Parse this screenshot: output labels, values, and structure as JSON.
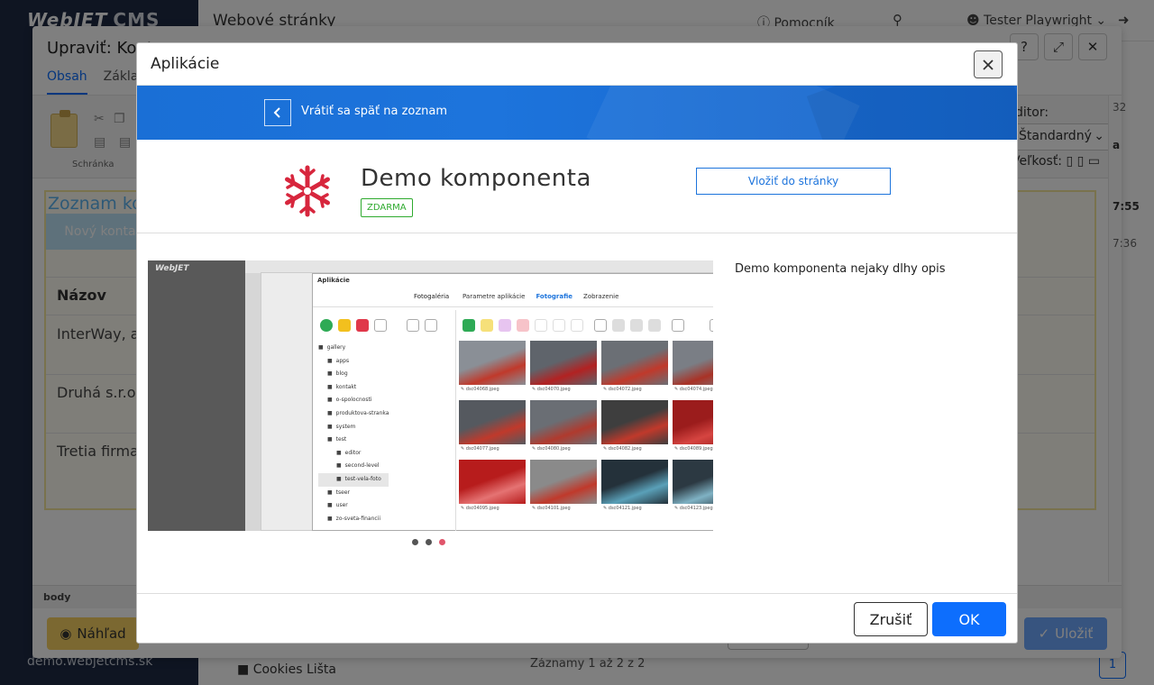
{
  "background_app": {
    "logo_text": "WebJET",
    "logo_cms": "CMS",
    "page_title": "Webové stránky",
    "help_label": "Pomocník",
    "user_label": "Tester Playwright",
    "domain_label": "demo.webjetcms.sk",
    "folder_label": "Cookies Lišta",
    "records_label": "Záznamy 1 až 2 z 2",
    "pagination_current": "1"
  },
  "editor_window": {
    "title": "Upraviť: Kont",
    "tabs": [
      "Obsah",
      "Základ"
    ],
    "active_tab_index": 0,
    "clipboard_label": "Schránka",
    "editor_label": "ditor:",
    "editor_select_value": "Štandardný",
    "size_label": "Veľkosť:",
    "right_number": "32",
    "right_time_1": "7:55",
    "right_time_2": "7:36",
    "right_letter": "a",
    "content": {
      "heading": "Zoznam kon",
      "new_button": "Nový konta",
      "column_header": "Názov",
      "rows": [
        "InterWay, a.",
        "Druhá s.r.o.",
        "Tretia firma a"
      ]
    },
    "status_path": "body",
    "preview_button": "Náhľad",
    "save_button": "Uložiť"
  },
  "modal": {
    "title": "Aplikácie",
    "back_label": "Vrátiť sa späť na zoznam",
    "app_name": "Demo komponenta",
    "price_badge": "ZDARMA",
    "insert_button": "Vložiť do stránky",
    "description": "Demo komponenta nejaky dlhy opis",
    "slides_count": 3,
    "active_slide_index": 2,
    "cancel_button": "Zrušiť",
    "ok_button": "OK",
    "colors": {
      "banner": "#1d74dc",
      "primary": "#0d6efd",
      "icon": "#d7263d",
      "free_badge": "#2eaa2e",
      "dot_active": "#e0556b"
    }
  },
  "slide_screenshot": {
    "dialog_title": "Aplikácie",
    "gallery_label": "Fotogaléria",
    "tabs": [
      "Parametre aplikácie",
      "Fotografie",
      "Zobrazenie"
    ],
    "active_tab_index": 1,
    "tree": [
      {
        "label": "gallery",
        "depth": 0
      },
      {
        "label": "apps",
        "depth": 1
      },
      {
        "label": "blog",
        "depth": 1
      },
      {
        "label": "kontakt",
        "depth": 1
      },
      {
        "label": "o-spolocnosti",
        "depth": 1
      },
      {
        "label": "produktova-stranka",
        "depth": 1
      },
      {
        "label": "system",
        "depth": 1
      },
      {
        "label": "test",
        "depth": 1
      },
      {
        "label": "editor",
        "depth": 2
      },
      {
        "label": "second-level",
        "depth": 2
      },
      {
        "label": "test-vela-foto",
        "depth": 2
      },
      {
        "label": "tseer",
        "depth": 1
      },
      {
        "label": "user",
        "depth": 1
      },
      {
        "label": "zo-sveta-financii",
        "depth": 1
      }
    ],
    "images": [
      "dsc04068.jpeg",
      "dsc04070.jpeg",
      "dsc04072.jpeg",
      "dsc04074.jpeg",
      "dsc04077.jpeg",
      "dsc04080.jpeg",
      "dsc04082.jpeg",
      "dsc04089.jpeg",
      "dsc04095.jpeg",
      "dsc04101.jpeg",
      "dsc04121.jpeg",
      "dsc04123.jpeg"
    ]
  }
}
